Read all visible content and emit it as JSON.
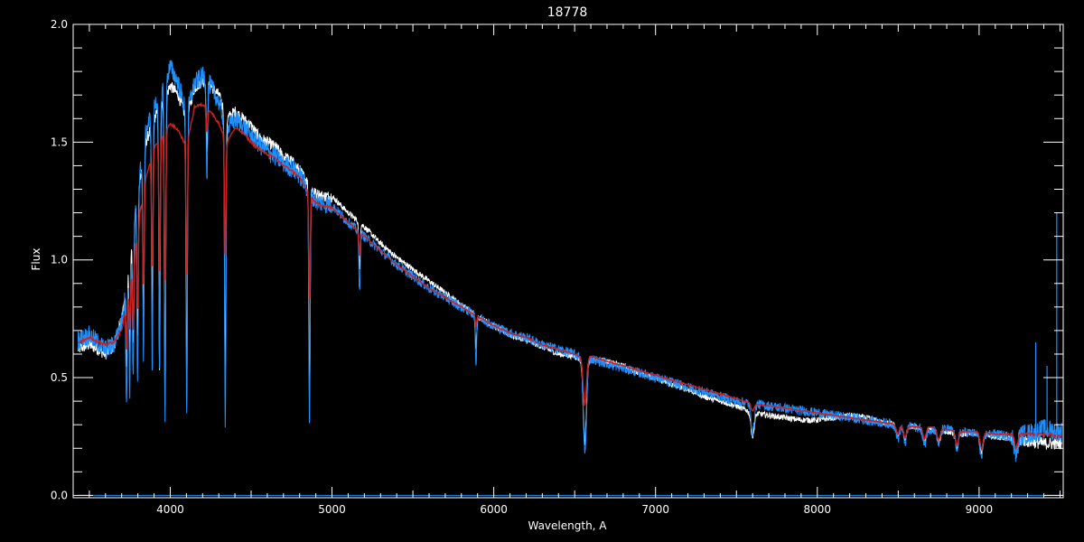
{
  "chart_data": {
    "type": "line",
    "title": "18778",
    "xlabel": "Wavelength, A",
    "ylabel": "Flux",
    "xlim": [
      3400,
      9520
    ],
    "ylim": [
      -0.01,
      2.0
    ],
    "xticks": [
      4000,
      5000,
      6000,
      7000,
      8000,
      9000
    ],
    "xtick_labels": [
      "4000",
      "5000",
      "6000",
      "7000",
      "8000",
      "9000"
    ],
    "yticks": [
      0.0,
      0.5,
      1.0,
      1.5,
      2.0
    ],
    "ytick_labels": [
      "0.0",
      "0.5",
      "1.0",
      "1.5",
      "2.0"
    ],
    "grid": false,
    "colors": {
      "background": "#000000",
      "axes": "#ffffff",
      "series_white": "#ffffff",
      "series_blue": "#1e90ff",
      "series_red": "#cc2222"
    },
    "series": [
      {
        "color": "#ffffff",
        "x": [
          3430,
          3500,
          3600,
          3650,
          3700,
          3750,
          3800,
          3850,
          3900,
          3950,
          4000,
          4050,
          4100,
          4150,
          4200,
          4250,
          4300,
          4350,
          4400,
          4450,
          4500,
          4550,
          4600,
          4650,
          4700,
          4750,
          4800,
          4850,
          4900,
          4950,
          5000,
          5100,
          5200,
          5300,
          5400,
          5500,
          5600,
          5700,
          5800,
          5900,
          6000,
          6100,
          6200,
          6300,
          6400,
          6500,
          6550,
          6600,
          6700,
          6800,
          6900,
          7000,
          7100,
          7200,
          7300,
          7400,
          7500,
          7600,
          7700,
          7800,
          7900,
          8000,
          8100,
          8200,
          8300,
          8400,
          8500,
          8600,
          8700,
          8800,
          8900,
          9000,
          9100,
          9200,
          9300,
          9400,
          9500
        ],
        "y": [
          0.62,
          0.64,
          0.6,
          0.63,
          0.75,
          1.02,
          1.3,
          1.5,
          1.6,
          1.66,
          1.74,
          1.7,
          1.6,
          1.73,
          1.76,
          1.74,
          1.7,
          1.6,
          1.63,
          1.6,
          1.57,
          1.52,
          1.5,
          1.48,
          1.44,
          1.42,
          1.38,
          1.33,
          1.28,
          1.27,
          1.27,
          1.2,
          1.14,
          1.07,
          1.01,
          0.96,
          0.91,
          0.86,
          0.81,
          0.76,
          0.72,
          0.68,
          0.66,
          0.63,
          0.6,
          0.59,
          0.57,
          0.58,
          0.57,
          0.55,
          0.52,
          0.5,
          0.47,
          0.45,
          0.42,
          0.4,
          0.38,
          0.35,
          0.34,
          0.33,
          0.32,
          0.32,
          0.33,
          0.34,
          0.33,
          0.31,
          0.3,
          0.29,
          0.28,
          0.27,
          0.26,
          0.26,
          0.25,
          0.24,
          0.23,
          0.22,
          0.22
        ]
      },
      {
        "color": "#1e90ff",
        "x": [
          3430,
          3500,
          3600,
          3650,
          3700,
          3750,
          3800,
          3850,
          3900,
          3950,
          4000,
          4050,
          4100,
          4150,
          4200,
          4250,
          4300,
          4350,
          4400,
          4450,
          4500,
          4550,
          4600,
          4650,
          4700,
          4750,
          4800,
          4850,
          4900,
          4950,
          5000,
          5100,
          5200,
          5300,
          5400,
          5500,
          5600,
          5700,
          5800,
          5900,
          6000,
          6100,
          6200,
          6300,
          6400,
          6500,
          6550,
          6600,
          6700,
          6800,
          6900,
          7000,
          7100,
          7200,
          7300,
          7400,
          7500,
          7600,
          7700,
          7800,
          7900,
          8000,
          8100,
          8200,
          8300,
          8400,
          8500,
          8600,
          8700,
          8800,
          8900,
          9000,
          9100,
          9200,
          9300,
          9400,
          9500
        ],
        "y": [
          0.66,
          0.68,
          0.62,
          0.64,
          0.74,
          1.0,
          1.3,
          1.55,
          1.65,
          1.72,
          1.82,
          1.75,
          1.62,
          1.75,
          1.78,
          1.74,
          1.67,
          1.55,
          1.6,
          1.57,
          1.53,
          1.49,
          1.46,
          1.44,
          1.41,
          1.39,
          1.36,
          1.3,
          1.25,
          1.24,
          1.23,
          1.16,
          1.1,
          1.04,
          0.98,
          0.93,
          0.88,
          0.84,
          0.8,
          0.76,
          0.72,
          0.69,
          0.67,
          0.64,
          0.62,
          0.6,
          0.58,
          0.58,
          0.56,
          0.54,
          0.52,
          0.5,
          0.48,
          0.46,
          0.44,
          0.42,
          0.4,
          0.39,
          0.38,
          0.37,
          0.36,
          0.35,
          0.34,
          0.33,
          0.32,
          0.31,
          0.3,
          0.29,
          0.28,
          0.28,
          0.27,
          0.26,
          0.26,
          0.25,
          0.26,
          0.28,
          0.27
        ]
      },
      {
        "color": "#cc2222",
        "x": [
          3430,
          3500,
          3600,
          3650,
          3700,
          3750,
          3800,
          3850,
          3900,
          3950,
          4000,
          4050,
          4100,
          4150,
          4200,
          4250,
          4300,
          4350,
          4400,
          4450,
          4500,
          4550,
          4600,
          4650,
          4700,
          4750,
          4800,
          4850,
          4900,
          4950,
          5000,
          5100,
          5200,
          5300,
          5400,
          5500,
          5600,
          5700,
          5800,
          5900,
          6000,
          6100,
          6200,
          6300,
          6400,
          6500,
          6550,
          6600,
          6700,
          6800,
          6900,
          7000,
          7100,
          7200,
          7300,
          7400,
          7500,
          7600,
          7700,
          7800,
          7900,
          8000,
          8100,
          8200,
          8300,
          8400,
          8500,
          8600,
          8700,
          8800,
          8900,
          9000,
          9100,
          9200,
          9300,
          9400,
          9500
        ],
        "y": [
          0.65,
          0.67,
          0.64,
          0.65,
          0.7,
          0.9,
          1.15,
          1.35,
          1.48,
          1.52,
          1.58,
          1.55,
          1.48,
          1.65,
          1.66,
          1.63,
          1.58,
          1.5,
          1.56,
          1.54,
          1.5,
          1.47,
          1.45,
          1.43,
          1.4,
          1.38,
          1.35,
          1.29,
          1.24,
          1.23,
          1.22,
          1.16,
          1.1,
          1.04,
          0.98,
          0.93,
          0.88,
          0.84,
          0.8,
          0.76,
          0.72,
          0.69,
          0.67,
          0.64,
          0.62,
          0.6,
          0.58,
          0.59,
          0.57,
          0.55,
          0.53,
          0.51,
          0.49,
          0.47,
          0.45,
          0.43,
          0.41,
          0.39,
          0.38,
          0.37,
          0.36,
          0.35,
          0.34,
          0.33,
          0.32,
          0.31,
          0.3,
          0.29,
          0.29,
          0.28,
          0.27,
          0.27,
          0.26,
          0.26,
          0.26,
          0.26,
          0.25
        ]
      }
    ],
    "absorption_lines": [
      {
        "x": 3730,
        "depth_white": 0.38,
        "depth_blue": 0.5,
        "depth_red": 0.2
      },
      {
        "x": 3750,
        "depth_white": 0.4,
        "depth_blue": 0.55,
        "depth_red": 0.2
      },
      {
        "x": 3771,
        "depth_white": 0.5,
        "depth_blue": 0.65,
        "depth_red": 0.3
      },
      {
        "x": 3798,
        "depth_white": 0.6,
        "depth_blue": 0.8,
        "depth_red": 0.35
      },
      {
        "x": 3835,
        "depth_white": 0.7,
        "depth_blue": 0.9,
        "depth_red": 0.4
      },
      {
        "x": 3889,
        "depth_white": 0.85,
        "depth_blue": 1.1,
        "depth_red": 0.5
      },
      {
        "x": 3934,
        "depth_white": 1.1,
        "depth_blue": 1.2,
        "depth_red": 0.55
      },
      {
        "x": 3968,
        "depth_white": 1.3,
        "depth_blue": 1.45,
        "depth_red": 0.7
      },
      {
        "x": 4102,
        "depth_white": 1.15,
        "depth_blue": 1.3,
        "depth_red": 0.55
      },
      {
        "x": 4227,
        "depth_white": 0.3,
        "depth_blue": 0.4,
        "depth_red": 0.1
      },
      {
        "x": 4340,
        "depth_white": 1.15,
        "depth_blue": 1.3,
        "depth_red": 0.55
      },
      {
        "x": 4861,
        "depth_white": 0.9,
        "depth_blue": 1.0,
        "depth_red": 0.45
      },
      {
        "x": 5170,
        "depth_white": 0.2,
        "depth_blue": 0.25,
        "depth_red": 0.1
      },
      {
        "x": 5890,
        "depth_white": 0.15,
        "depth_blue": 0.2,
        "depth_red": 0.05
      },
      {
        "x": 6563,
        "depth_white": 0.35,
        "depth_blue": 0.4,
        "depth_red": 0.2
      },
      {
        "x": 7600,
        "depth_white": 0.1,
        "depth_blue": 0.12,
        "depth_red": 0.03
      },
      {
        "x": 8498,
        "depth_white": 0.05,
        "depth_blue": 0.06,
        "depth_red": 0.04
      },
      {
        "x": 8542,
        "depth_white": 0.06,
        "depth_blue": 0.07,
        "depth_red": 0.05
      },
      {
        "x": 8662,
        "depth_white": 0.06,
        "depth_blue": 0.07,
        "depth_red": 0.05
      },
      {
        "x": 8750,
        "depth_white": 0.05,
        "depth_blue": 0.06,
        "depth_red": 0.05
      },
      {
        "x": 8863,
        "depth_white": 0.06,
        "depth_blue": 0.07,
        "depth_red": 0.06
      },
      {
        "x": 9015,
        "depth_white": 0.08,
        "depth_blue": 0.1,
        "depth_red": 0.07
      },
      {
        "x": 9229,
        "depth_white": 0.06,
        "depth_blue": 0.08,
        "depth_red": 0.06
      }
    ],
    "baseline": {
      "color": "#1e90ff",
      "x": [
        3430,
        9520
      ],
      "y": [
        0.0,
        0.0
      ]
    }
  }
}
